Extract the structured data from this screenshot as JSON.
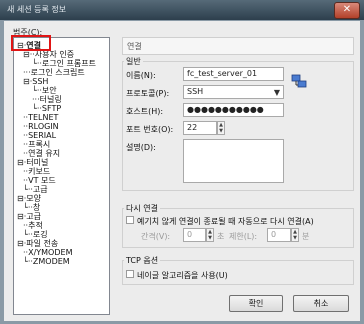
{
  "window": {
    "title": "새 세션 등록 정보",
    "close": "✕"
  },
  "category_label": "범주(C):",
  "tree": {
    "items": [
      {
        "label": "연결",
        "prefix": "⊟·"
      },
      {
        "label": "사용자 인증",
        "prefix": "⊟··"
      },
      {
        "label": "로그인 프롬프트",
        "prefix": "└··"
      },
      {
        "label": "로그인 스크립트",
        "prefix": "···"
      },
      {
        "label": "SSH",
        "prefix": "⊟·"
      },
      {
        "label": "보안",
        "prefix": "└··"
      },
      {
        "label": "터널링",
        "prefix": "···"
      },
      {
        "label": "SFTP",
        "prefix": "└··"
      },
      {
        "label": "TELNET",
        "prefix": "··"
      },
      {
        "label": "RLOGIN",
        "prefix": "··"
      },
      {
        "label": "SERIAL",
        "prefix": "··"
      },
      {
        "label": "프록시",
        "prefix": "··"
      },
      {
        "label": "연결 유지",
        "prefix": "··"
      },
      {
        "label": "터미널",
        "prefix": "⊟·"
      },
      {
        "label": "키보드",
        "prefix": "··"
      },
      {
        "label": "VT 모드",
        "prefix": "··"
      },
      {
        "label": "고급",
        "prefix": "└··"
      },
      {
        "label": "모양",
        "prefix": "⊟·"
      },
      {
        "label": "창",
        "prefix": "└··"
      },
      {
        "label": "고급",
        "prefix": "⊟·"
      },
      {
        "label": "추적",
        "prefix": "··"
      },
      {
        "label": "로깅",
        "prefix": "└··"
      },
      {
        "label": "파일 전송",
        "prefix": "⊟·"
      },
      {
        "label": "X/YMODEM",
        "prefix": "··"
      },
      {
        "label": "ZMODEM",
        "prefix": "└··"
      }
    ]
  },
  "panel": {
    "title": "연결",
    "general": {
      "label": "일반",
      "name_label": "이름(N):",
      "name_value": "fc_test_server_01",
      "protocol_label": "프로토콜(P):",
      "protocol_value": "SSH",
      "host_label": "호스트(H):",
      "host_value": "●●●●●●●●●●●",
      "port_label": "포트 번호(O):",
      "port_value": "22",
      "desc_label": "설명(D):",
      "desc_value": ""
    },
    "reconnect": {
      "label": "다시 연결",
      "auto_label": "예기치 않게 연결이 종료될 때 자동으로 다시 연결(A)",
      "interval_label": "간격(V):",
      "interval_value": "0",
      "seconds_unit": "초",
      "limit_label": "제한(L):",
      "limit_value": "0",
      "minutes_unit": "분"
    },
    "tcp": {
      "label": "TCP 옵션",
      "nagle_label": "네이글 알고리즘을 사용(U)"
    }
  },
  "buttons": {
    "ok": "확인",
    "cancel": "취소"
  },
  "colors": {
    "highlight": "#e01515",
    "titlebar": "#2d3f4d"
  }
}
